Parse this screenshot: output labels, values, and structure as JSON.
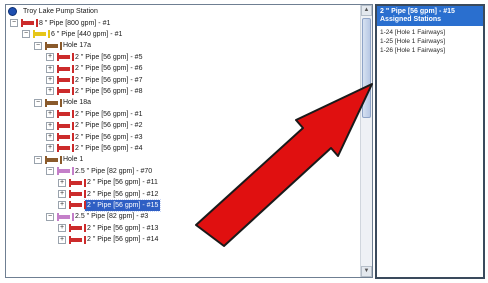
{
  "tree": {
    "root": "Troy Lake Pump Station",
    "rows": [
      {
        "id": "r1",
        "indent": 1,
        "twist": "−",
        "pipe": "#cc2b2b",
        "label": "8 \" Pipe [800 gpm] - #1"
      },
      {
        "id": "r2",
        "indent": 2,
        "twist": "−",
        "pipe": "#e6c619",
        "label": "6 \" Pipe [440 gpm] - #1"
      },
      {
        "id": "r3",
        "indent": 3,
        "twist": "−",
        "pipe": "#8a5a2b",
        "label": "Hole 17a"
      },
      {
        "id": "r4",
        "indent": 4,
        "twist": "+",
        "pipe": "#cc2b2b",
        "label": "2 \" Pipe [56 gpm] - #5"
      },
      {
        "id": "r5",
        "indent": 4,
        "twist": "+",
        "pipe": "#cc2b2b",
        "label": "2 \" Pipe [56 gpm] - #6"
      },
      {
        "id": "r6",
        "indent": 4,
        "twist": "+",
        "pipe": "#cc2b2b",
        "label": "2 \" Pipe [56 gpm] - #7"
      },
      {
        "id": "r7",
        "indent": 4,
        "twist": "+",
        "pipe": "#cc2b2b",
        "label": "2 \" Pipe [56 gpm] - #8"
      },
      {
        "id": "r8",
        "indent": 3,
        "twist": "−",
        "pipe": "#8a5a2b",
        "label": "Hole 18a"
      },
      {
        "id": "r9",
        "indent": 4,
        "twist": "+",
        "pipe": "#cc2b2b",
        "label": "2 \" Pipe [56 gpm] - #1"
      },
      {
        "id": "r10",
        "indent": 4,
        "twist": "+",
        "pipe": "#cc2b2b",
        "label": "2 \" Pipe [56 gpm] - #2"
      },
      {
        "id": "r11",
        "indent": 4,
        "twist": "+",
        "pipe": "#cc2b2b",
        "label": "2 \" Pipe [56 gpm] - #3"
      },
      {
        "id": "r12",
        "indent": 4,
        "twist": "+",
        "pipe": "#cc2b2b",
        "label": "2 \" Pipe [56 gpm] - #4"
      },
      {
        "id": "r13",
        "indent": 3,
        "twist": "−",
        "pipe": "#8a5a2b",
        "label": "Hole 1"
      },
      {
        "id": "r14",
        "indent": 4,
        "twist": "−",
        "pipe": "#c47fc9",
        "label": "2.5 \" Pipe [82 gpm] - #70"
      },
      {
        "id": "r15",
        "indent": 5,
        "twist": "+",
        "pipe": "#cc2b2b",
        "label": "2 \" Pipe [56 gpm] - #11"
      },
      {
        "id": "r16",
        "indent": 5,
        "twist": "+",
        "pipe": "#cc2b2b",
        "label": "2 \" Pipe [56 gpm] - #12"
      },
      {
        "id": "r17",
        "indent": 5,
        "twist": "+",
        "pipe": "#cc2b2b",
        "label": "2 \" Pipe [56 gpm] - #15",
        "selected": true
      },
      {
        "id": "r18",
        "indent": 4,
        "twist": "−",
        "pipe": "#c47fc9",
        "label": "2.5 \" Pipe [82 gpm] - #3"
      },
      {
        "id": "r19",
        "indent": 5,
        "twist": "+",
        "pipe": "#cc2b2b",
        "label": "2 \" Pipe [56 gpm] - #13"
      },
      {
        "id": "r20",
        "indent": 5,
        "twist": "+",
        "pipe": "#cc2b2b",
        "label": "2 \" Pipe [56 gpm] - #14"
      }
    ]
  },
  "details": {
    "title": "2 \" Pipe [56 gpm] - #15",
    "subtitle": "Assigned Stations",
    "stations": [
      "1-24  [Hole 1 Fairways]",
      "1-25  [Hole 1 Fairways]",
      "1-26  [Hole 1 Fairways]"
    ]
  },
  "colors": {
    "selection": "#2f5fc4",
    "header": "#2a6fcf",
    "arrow": "#e01010"
  }
}
